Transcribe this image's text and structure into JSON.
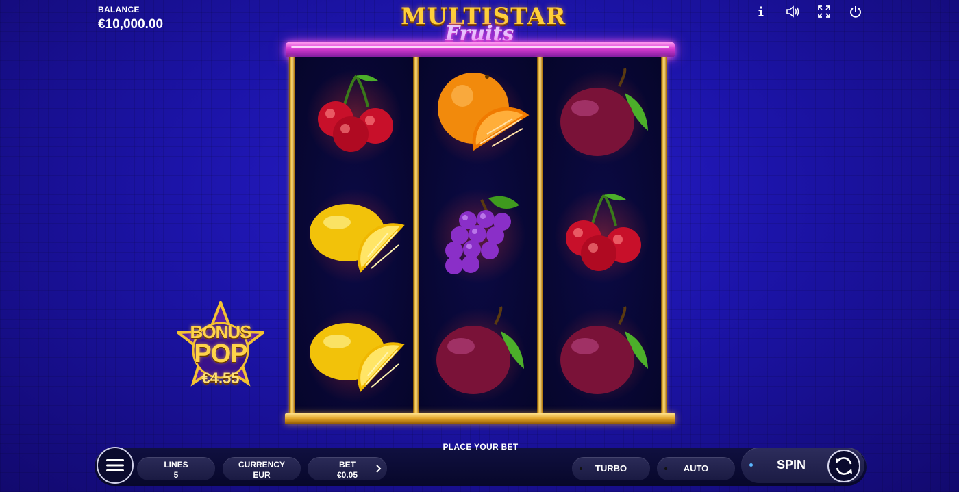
{
  "balance": {
    "label": "BALANCE",
    "value": "€10,000.00"
  },
  "logo": {
    "line1": "MULTISTAR",
    "line2": "Fruits"
  },
  "top_icons": [
    "info-icon",
    "sound-icon",
    "fullscreen-icon",
    "power-icon"
  ],
  "reels": [
    [
      "cherry",
      "lemon",
      "lemon"
    ],
    [
      "orange",
      "grapes",
      "plum"
    ],
    [
      "plum",
      "cherry",
      "plum"
    ]
  ],
  "bonus": {
    "line1": "BONUS",
    "line2": "POP",
    "amount": "€4.55"
  },
  "controls": {
    "place_bet": "PLACE YOUR BET",
    "lines_label": "LINES",
    "lines_value": "5",
    "currency_label": "CURRENCY",
    "currency_value": "EUR",
    "bet_label": "BET",
    "bet_value": "€0.05",
    "turbo": "TURBO",
    "auto": "AUTO",
    "spin": "SPIN"
  },
  "colors": {
    "background": "#1c14a8",
    "neon": "#ff5ce8",
    "gold": "#ffd45a",
    "spin_dot": "#5ab6ff"
  }
}
